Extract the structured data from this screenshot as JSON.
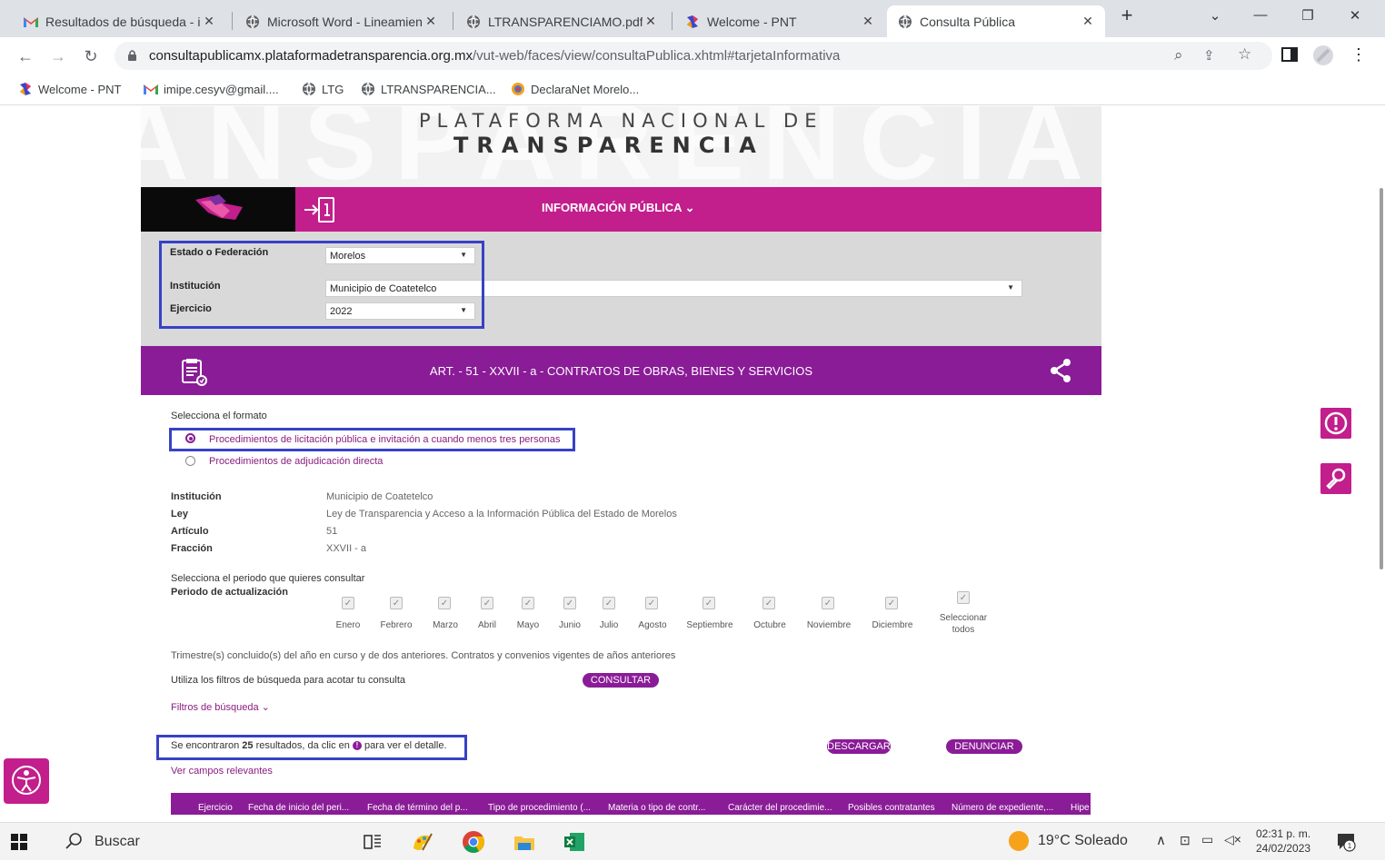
{
  "browser": {
    "tabs": [
      {
        "label": "Resultados de búsqueda - im",
        "icon": "gmail-icon"
      },
      {
        "label": "Microsoft Word - Lineamien",
        "icon": "globe-icon"
      },
      {
        "label": "LTRANSPARENCIAMO.pdf",
        "icon": "globe-icon"
      },
      {
        "label": "Welcome - PNT",
        "icon": "pnt-icon"
      },
      {
        "label": "Consulta Pública",
        "icon": "globe-icon",
        "active": true
      }
    ],
    "url_host": "consultapublicamx.plataformadetransparencia.org.mx",
    "url_path": "/vut-web/faces/view/consultaPublica.xhtml#tarjetaInformativa",
    "bookmarks": [
      {
        "label": "Welcome - PNT",
        "icon": "pnt-icon"
      },
      {
        "label": "imipe.cesyv@gmail....",
        "icon": "gmail-icon"
      },
      {
        "label": "LTG",
        "icon": "globe-icon"
      },
      {
        "label": "LTRANSPARENCIA...",
        "icon": "globe-icon"
      },
      {
        "label": "DeclaraNet Morelo...",
        "icon": "declaranet-icon"
      }
    ]
  },
  "header": {
    "line1": "PLATAFORMA NACIONAL DE",
    "line2": "TRANSPARENCIA",
    "menu": "INFORMACIÓN PÚBLICA ⌄"
  },
  "filters": {
    "estado_label": "Estado o Federación",
    "estado_value": "Morelos",
    "institucion_label": "Institución",
    "institucion_value": "Municipio de Coatetelco",
    "ejercicio_label": "Ejercicio",
    "ejercicio_value": "2022"
  },
  "article": {
    "title": "ART. - 51 - XXVII - a - CONTRATOS DE OBRAS, BIENES Y SERVICIOS"
  },
  "format": {
    "prompt": "Selecciona el formato",
    "option1": "Procedimientos de licitación pública e invitación a cuando menos tres personas",
    "option2": "Procedimientos de adjudicación directa"
  },
  "details": {
    "rows": [
      {
        "label": "Institución",
        "value": "Municipio de Coatetelco"
      },
      {
        "label": "Ley",
        "value": "Ley de Transparencia y Acceso a la Información Pública del Estado de Morelos"
      },
      {
        "label": "Artículo",
        "value": "51"
      },
      {
        "label": "Fracción",
        "value": "XXVII - a"
      }
    ]
  },
  "period": {
    "prompt": "Selecciona el periodo que quieres consultar",
    "label": "Periodo de actualización",
    "months": [
      "Enero",
      "Febrero",
      "Marzo",
      "Abril",
      "Mayo",
      "Junio",
      "Julio",
      "Agosto",
      "Septiembre",
      "Octubre",
      "Noviembre",
      "Diciembre"
    ],
    "select_all_1": "Seleccionar",
    "select_all_2": "todos",
    "note": "Trimestre(s) concluido(s) del año en curso y de dos anteriores. Contratos y convenios vigentes de años anteriores"
  },
  "search": {
    "hint": "Utiliza los filtros de búsqueda para acotar tu consulta",
    "consultar": "CONSULTAR",
    "filters_link": "Filtros de búsqueda ⌄"
  },
  "results": {
    "prefix": "Se encontraron ",
    "count": "25",
    "suffix_1": " resultados, da clic en ",
    "suffix_2": " para ver el detalle.",
    "descargar": "DESCARGAR",
    "denunciar": "DENUNCIAR",
    "relevant": "Ver campos relevantes"
  },
  "table": {
    "headers": [
      "Ejercicio",
      "Fecha de inicio del peri...",
      "Fecha de término del p...",
      "Tipo de procedimiento (...",
      "Materia o tipo de contr...",
      "Carácter del procedimie...",
      "Posibles contratantes",
      "Número de expediente,...",
      "Hipe"
    ]
  },
  "taskbar": {
    "search": "Buscar",
    "weather": "19°C  Soleado",
    "time": "02:31 p. m.",
    "date": "24/02/2023"
  },
  "colors": {
    "magenta": "#c21e8c",
    "purple": "#8a1c97",
    "highlight_box": "#3742c6"
  }
}
